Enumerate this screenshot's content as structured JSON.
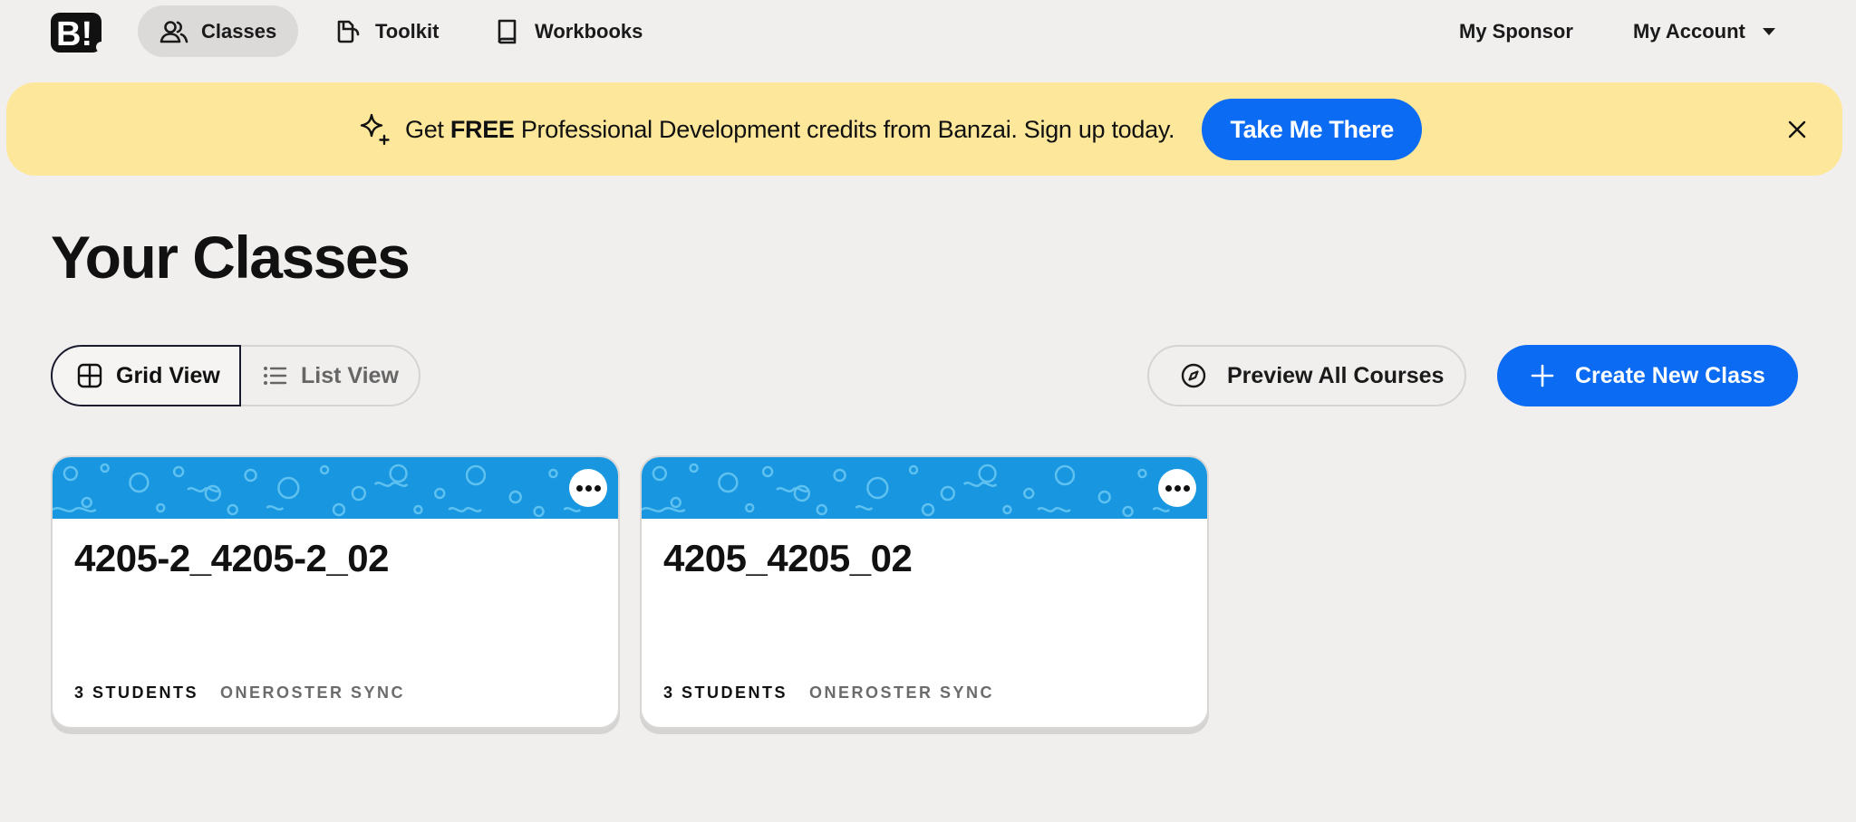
{
  "nav": {
    "logo_text": "B!",
    "items": [
      {
        "label": "Classes",
        "icon": "users-icon"
      },
      {
        "label": "Toolkit",
        "icon": "toolkit-icon"
      },
      {
        "label": "Workbooks",
        "icon": "book-icon"
      }
    ],
    "sponsor": "My Sponsor",
    "account": "My Account"
  },
  "banner": {
    "text_pre": "Get ",
    "text_bold": "FREE",
    "text_post": " Professional Development credits from Banzai. Sign up today.",
    "button": "Take Me There",
    "bg_color": "#fde79b"
  },
  "page_title": "Your Classes",
  "view_toggle": {
    "grid": "Grid View",
    "list": "List View",
    "selected": "Grid View"
  },
  "actions": {
    "preview": "Preview All Courses",
    "create": "Create New Class",
    "accent": "#0b6bf2"
  },
  "classes": [
    {
      "name": "4205-2_4205-2_02",
      "students": "3 STUDENTS",
      "sync": "ONEROSTER SYNC"
    },
    {
      "name": "4205_4205_02",
      "students": "3 STUDENTS",
      "sync": "ONEROSTER SYNC"
    }
  ]
}
